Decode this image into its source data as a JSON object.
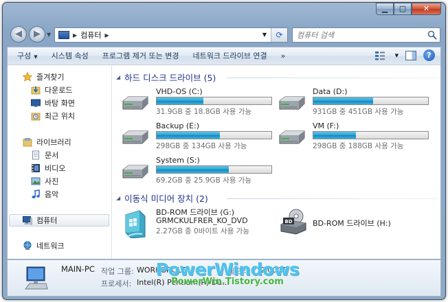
{
  "window": {
    "minimize_glyph": "▁",
    "maximize_glyph": "▢",
    "close_glyph": "✕"
  },
  "navigation": {
    "back_glyph": "◀",
    "forward_glyph": "▶",
    "address_crumb": "컴퓨터",
    "address_arrow": "▶",
    "refresh_glyph": "⟳",
    "search_placeholder": "컴퓨터 검색"
  },
  "toolbar": {
    "items": [
      "구성",
      "시스템 속성",
      "프로그램 제거 또는 변경",
      "네트워크 드라이브 연결",
      "»"
    ],
    "dropdown_glyph": "▼"
  },
  "sidebar": {
    "favorites": "즐겨찾기",
    "favorites_items": [
      "다운로드",
      "바탕 화면",
      "최근 위치"
    ],
    "libraries": "라이브러리",
    "libraries_items": [
      "문서",
      "비디오",
      "사진",
      "음악"
    ],
    "computer": "컴퓨터",
    "network": "네트워크"
  },
  "main": {
    "hard_disks_header": "하드 디스크 드라이브 (5)",
    "removable_header": "이동식 미디어 장치 (2)",
    "group_triangle": "◢",
    "drives": [
      {
        "name": "VHD-OS (C:)",
        "free": "31.9GB 중 18.8GB 사용 가능",
        "used_fraction": 0.41
      },
      {
        "name": "Data (D:)",
        "free": "931GB 중 451GB 사용 가능",
        "used_fraction": 0.52
      },
      {
        "name": "Backup (E:)",
        "free": "298GB 중 134GB 사용 가능",
        "used_fraction": 0.55
      },
      {
        "name": "VM (F:)",
        "free": "298GB 중 188GB 사용 가능",
        "used_fraction": 0.37
      },
      {
        "name": "System (S:)",
        "free": "69.2GB 중 25.9GB 사용 가능",
        "used_fraction": 0.63
      }
    ],
    "removable": [
      {
        "name": "BD-ROM 드라이브 (G:)",
        "label": "GRMCKULFRER_KO_DVD",
        "free": "2.27GB 중 0바이트 사용 가능"
      },
      {
        "name": "BD-ROM 드라이브 (H:)",
        "icon_text": "BD"
      }
    ]
  },
  "details": {
    "computer_name": "MAIN-PC",
    "workgroup_label": "작업 그룹:",
    "workgroup_value": "WORKGROUP",
    "processor_label": "프로세서:",
    "processor_value": "Intel(R) Pentium(R) Du...",
    "memory_label": "메모리:",
    "memory_value": "2.00GB"
  },
  "watermark": {
    "title": "PowerWindows",
    "subtitle": "PowerWin.Tistory.com"
  },
  "colors": {
    "accent": "#1e3287",
    "bar_fill": "#2aa0d2",
    "watermark_blue": "#4bc3ee",
    "watermark_green": "#42b63e"
  }
}
